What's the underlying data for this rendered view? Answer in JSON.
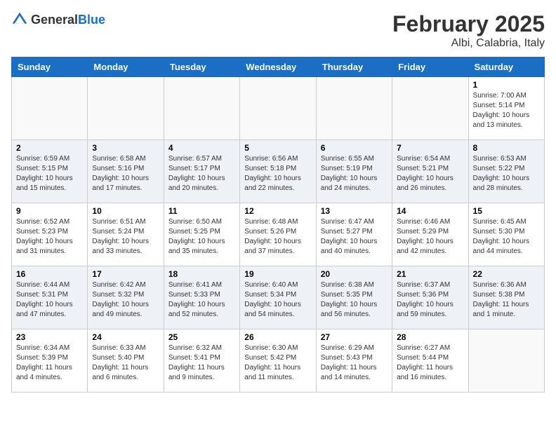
{
  "header": {
    "logo_general": "General",
    "logo_blue": "Blue",
    "month": "February 2025",
    "location": "Albi, Calabria, Italy"
  },
  "weekdays": [
    "Sunday",
    "Monday",
    "Tuesday",
    "Wednesday",
    "Thursday",
    "Friday",
    "Saturday"
  ],
  "weeks": [
    [
      {
        "day": "",
        "info": ""
      },
      {
        "day": "",
        "info": ""
      },
      {
        "day": "",
        "info": ""
      },
      {
        "day": "",
        "info": ""
      },
      {
        "day": "",
        "info": ""
      },
      {
        "day": "",
        "info": ""
      },
      {
        "day": "1",
        "info": "Sunrise: 7:00 AM\nSunset: 5:14 PM\nDaylight: 10 hours\nand 13 minutes."
      }
    ],
    [
      {
        "day": "2",
        "info": "Sunrise: 6:59 AM\nSunset: 5:15 PM\nDaylight: 10 hours\nand 15 minutes."
      },
      {
        "day": "3",
        "info": "Sunrise: 6:58 AM\nSunset: 5:16 PM\nDaylight: 10 hours\nand 17 minutes."
      },
      {
        "day": "4",
        "info": "Sunrise: 6:57 AM\nSunset: 5:17 PM\nDaylight: 10 hours\nand 20 minutes."
      },
      {
        "day": "5",
        "info": "Sunrise: 6:56 AM\nSunset: 5:18 PM\nDaylight: 10 hours\nand 22 minutes."
      },
      {
        "day": "6",
        "info": "Sunrise: 6:55 AM\nSunset: 5:19 PM\nDaylight: 10 hours\nand 24 minutes."
      },
      {
        "day": "7",
        "info": "Sunrise: 6:54 AM\nSunset: 5:21 PM\nDaylight: 10 hours\nand 26 minutes."
      },
      {
        "day": "8",
        "info": "Sunrise: 6:53 AM\nSunset: 5:22 PM\nDaylight: 10 hours\nand 28 minutes."
      }
    ],
    [
      {
        "day": "9",
        "info": "Sunrise: 6:52 AM\nSunset: 5:23 PM\nDaylight: 10 hours\nand 31 minutes."
      },
      {
        "day": "10",
        "info": "Sunrise: 6:51 AM\nSunset: 5:24 PM\nDaylight: 10 hours\nand 33 minutes."
      },
      {
        "day": "11",
        "info": "Sunrise: 6:50 AM\nSunset: 5:25 PM\nDaylight: 10 hours\nand 35 minutes."
      },
      {
        "day": "12",
        "info": "Sunrise: 6:48 AM\nSunset: 5:26 PM\nDaylight: 10 hours\nand 37 minutes."
      },
      {
        "day": "13",
        "info": "Sunrise: 6:47 AM\nSunset: 5:27 PM\nDaylight: 10 hours\nand 40 minutes."
      },
      {
        "day": "14",
        "info": "Sunrise: 6:46 AM\nSunset: 5:29 PM\nDaylight: 10 hours\nand 42 minutes."
      },
      {
        "day": "15",
        "info": "Sunrise: 6:45 AM\nSunset: 5:30 PM\nDaylight: 10 hours\nand 44 minutes."
      }
    ],
    [
      {
        "day": "16",
        "info": "Sunrise: 6:44 AM\nSunset: 5:31 PM\nDaylight: 10 hours\nand 47 minutes."
      },
      {
        "day": "17",
        "info": "Sunrise: 6:42 AM\nSunset: 5:32 PM\nDaylight: 10 hours\nand 49 minutes."
      },
      {
        "day": "18",
        "info": "Sunrise: 6:41 AM\nSunset: 5:33 PM\nDaylight: 10 hours\nand 52 minutes."
      },
      {
        "day": "19",
        "info": "Sunrise: 6:40 AM\nSunset: 5:34 PM\nDaylight: 10 hours\nand 54 minutes."
      },
      {
        "day": "20",
        "info": "Sunrise: 6:38 AM\nSunset: 5:35 PM\nDaylight: 10 hours\nand 56 minutes."
      },
      {
        "day": "21",
        "info": "Sunrise: 6:37 AM\nSunset: 5:36 PM\nDaylight: 10 hours\nand 59 minutes."
      },
      {
        "day": "22",
        "info": "Sunrise: 6:36 AM\nSunset: 5:38 PM\nDaylight: 11 hours\nand 1 minute."
      }
    ],
    [
      {
        "day": "23",
        "info": "Sunrise: 6:34 AM\nSunset: 5:39 PM\nDaylight: 11 hours\nand 4 minutes."
      },
      {
        "day": "24",
        "info": "Sunrise: 6:33 AM\nSunset: 5:40 PM\nDaylight: 11 hours\nand 6 minutes."
      },
      {
        "day": "25",
        "info": "Sunrise: 6:32 AM\nSunset: 5:41 PM\nDaylight: 11 hours\nand 9 minutes."
      },
      {
        "day": "26",
        "info": "Sunrise: 6:30 AM\nSunset: 5:42 PM\nDaylight: 11 hours\nand 11 minutes."
      },
      {
        "day": "27",
        "info": "Sunrise: 6:29 AM\nSunset: 5:43 PM\nDaylight: 11 hours\nand 14 minutes."
      },
      {
        "day": "28",
        "info": "Sunrise: 6:27 AM\nSunset: 5:44 PM\nDaylight: 11 hours\nand 16 minutes."
      },
      {
        "day": "",
        "info": ""
      }
    ]
  ]
}
